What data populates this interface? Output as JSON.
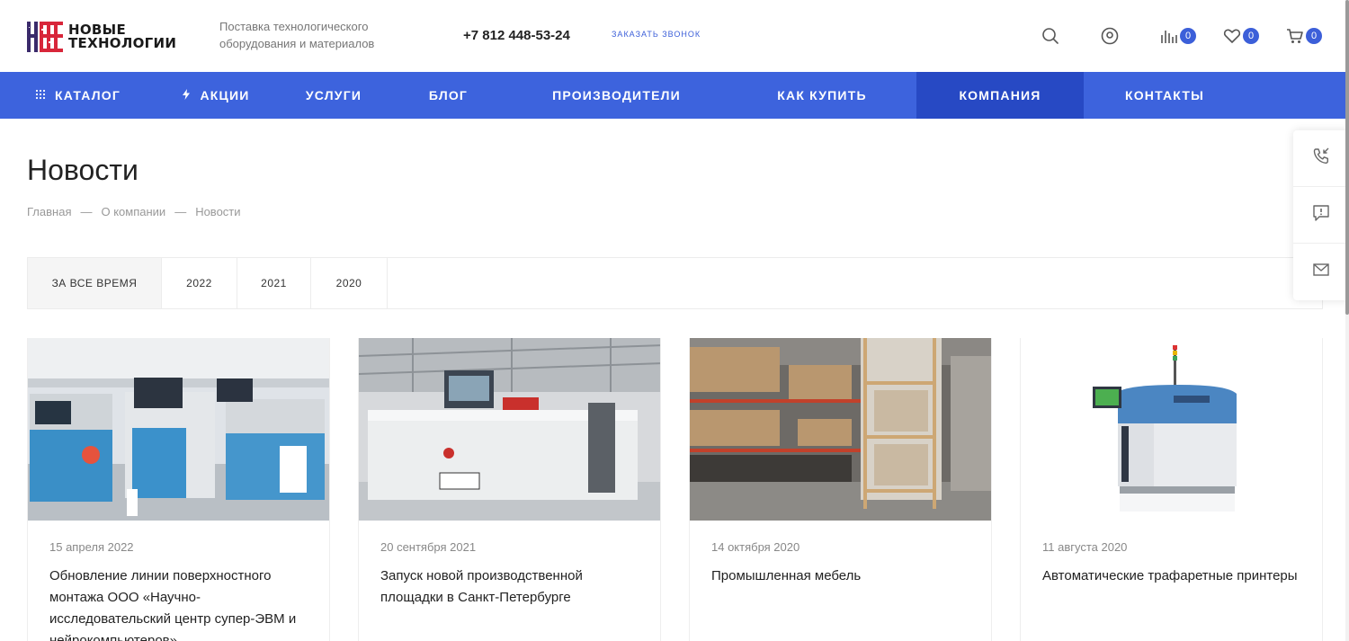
{
  "header": {
    "logo": {
      "line1": "НОВЫЕ",
      "line2": "ТЕХНОЛОГИИ"
    },
    "tagline": "Поставка технологического оборудования и материалов",
    "phone": "+7 812 448-53-24",
    "callback_label": "ЗАКАЗАТЬ ЗВОНОК",
    "icons": {
      "search": "search-icon",
      "account": "user-icon",
      "compare": {
        "icon": "compare-icon",
        "count": "0"
      },
      "favorites": {
        "icon": "heart-icon",
        "count": "0"
      },
      "cart": {
        "icon": "cart-icon",
        "count": "0"
      }
    }
  },
  "nav": {
    "items": [
      {
        "label": "КАТАЛОГ",
        "icon": "grid-icon"
      },
      {
        "label": "АКЦИИ",
        "icon": "lightning-icon"
      },
      {
        "label": "УСЛУГИ"
      },
      {
        "label": "БЛОГ"
      },
      {
        "label": "ПРОИЗВОДИТЕЛИ"
      },
      {
        "label": "КАК КУПИТЬ"
      },
      {
        "label": "КОМПАНИЯ",
        "active": true
      },
      {
        "label": "КОНТАКТЫ"
      }
    ]
  },
  "page": {
    "title": "Новости",
    "breadcrumb": [
      "Главная",
      "О компании",
      "Новости"
    ],
    "breadcrumb_separator": "—"
  },
  "filters": [
    "ЗА ВСЕ ВРЕМЯ",
    "2022",
    "2021",
    "2020"
  ],
  "active_filter": "ЗА ВСЕ ВРЕМЯ",
  "side_widget": [
    "phone-callback-icon",
    "chat-icon",
    "mail-icon"
  ],
  "news": [
    {
      "date": "15 апреля 2022",
      "title": "Обновление линии поверхностного монтажа ООО «Научно-исследовательский центр супер-ЭВМ и нейрокомпьютеров»"
    },
    {
      "date": "20 сентября 2021",
      "title": "Запуск новой производственной площадки в Санкт-Петербурге"
    },
    {
      "date": "14 октября 2020",
      "title": "Промышленная мебель"
    },
    {
      "date": "11 августа 2020",
      "title": "Автоматические трафаретные принтеры"
    }
  ],
  "colors": {
    "accent": "#3d63dd",
    "accent_active": "#2749c4",
    "logo_red": "#d8263a",
    "logo_purple": "#3a2a6b"
  }
}
